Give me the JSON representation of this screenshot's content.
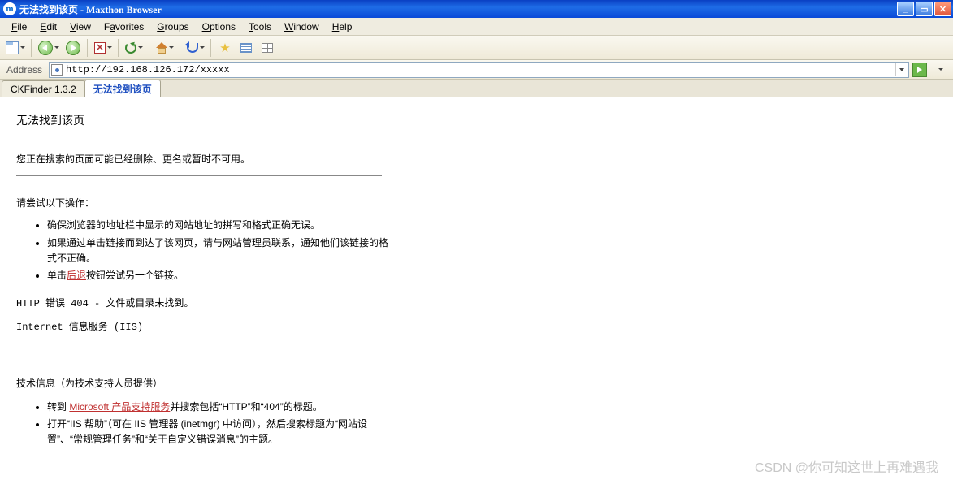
{
  "title": "无法找到该页 - Maxthon Browser",
  "menu": {
    "file": "File",
    "edit": "Edit",
    "view": "View",
    "favorites": "Favorites",
    "groups": "Groups",
    "options": "Options",
    "tools": "Tools",
    "window": "Window",
    "help": "Help"
  },
  "addressbar": {
    "label": "Address",
    "url": "http://192.168.126.172/xxxxx"
  },
  "tabs": [
    {
      "label": "CKFinder 1.3.2",
      "active": false
    },
    {
      "label": "无法找到该页",
      "active": true
    }
  ],
  "page": {
    "heading": "无法找到该页",
    "desc": "您正在搜索的页面可能已经删除、更名或暂时不可用。",
    "try_label": "请尝试以下操作：",
    "bullets": [
      "确保浏览器的地址栏中显示的网站地址的拼写和格式正确无误。",
      "如果通过单击链接而到达了该网页，请与网站管理员联系，通知他们该链接的格式不正确。",
      "单击"
    ],
    "back_link": "后退",
    "back_suffix": "按钮尝试另一个链接。",
    "error_line": "HTTP 错误 404 - 文件或目录未找到。",
    "iis_line": "Internet 信息服务 (IIS)",
    "tech_heading": "技术信息（为技术支持人员提供）",
    "tech_b1_prefix": "转到 ",
    "tech_link": "Microsoft 产品支持服务",
    "tech_b1_suffix": "并搜索包括“HTTP”和“404”的标题。",
    "tech_b2": "打开“IIS 帮助”（可在 IIS 管理器 (inetmgr) 中访问），然后搜索标题为“网站设置”、“常规管理任务”和“关于自定义错误消息”的主题。"
  },
  "watermark": "CSDN @你可知这世上再难遇我"
}
